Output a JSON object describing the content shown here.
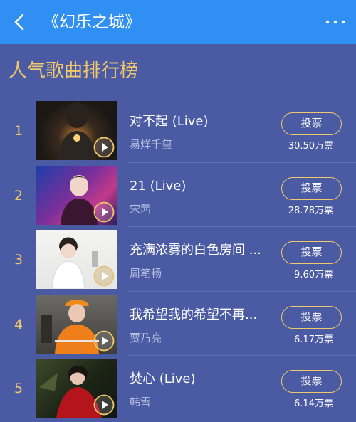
{
  "header": {
    "title": "《幻乐之城》",
    "back_icon": "chevron-left-icon",
    "more_icon": "more-horizontal-icon",
    "bar_color": "#2f8ff2"
  },
  "section": {
    "title": "人气歌曲排行榜",
    "accent_color": "#f2c86c"
  },
  "songs": [
    {
      "rank": "1",
      "name": "对不起 (Live)",
      "artist": "易烊千玺",
      "vote_label": "投票",
      "votes": "30.50万票"
    },
    {
      "rank": "2",
      "name": "21 (Live)",
      "artist": "宋茜",
      "vote_label": "投票",
      "votes": "28.78万票"
    },
    {
      "rank": "3",
      "name": "充满浓雾的白色房间 ...",
      "artist": "周笔畅",
      "vote_label": "投票",
      "votes": "9.60万票"
    },
    {
      "rank": "4",
      "name": "我希望我的希望不再...",
      "artist": "贾乃亮",
      "vote_label": "投票",
      "votes": "6.17万票"
    },
    {
      "rank": "5",
      "name": "焚心 (Live)",
      "artist": "韩雪",
      "vote_label": "投票",
      "votes": "6.14万票"
    }
  ]
}
